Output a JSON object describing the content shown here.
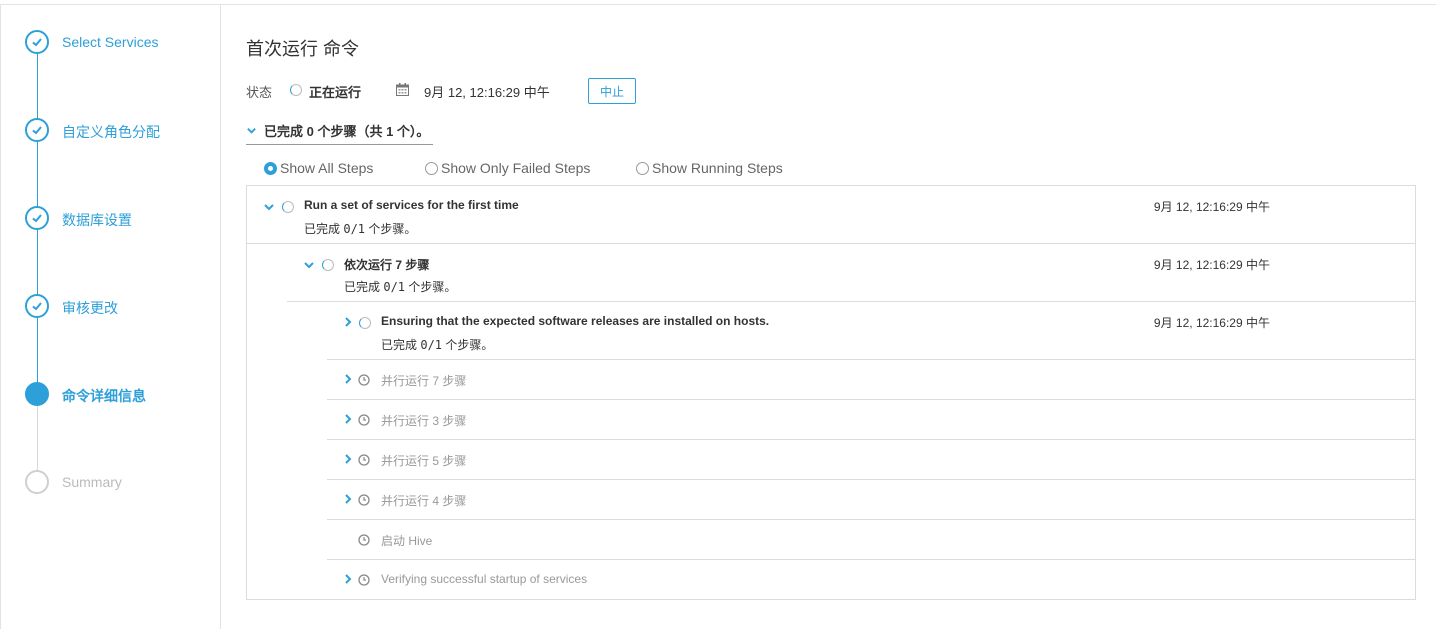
{
  "sidebar": {
    "steps": [
      {
        "label": "Select Services",
        "state": "done"
      },
      {
        "label": "自定义角色分配",
        "state": "done"
      },
      {
        "label": "数据库设置",
        "state": "done"
      },
      {
        "label": "审核更改",
        "state": "done"
      },
      {
        "label": "命令详细信息",
        "state": "active"
      },
      {
        "label": "Summary",
        "state": "pending"
      }
    ]
  },
  "header": {
    "title": "首次运行 命令"
  },
  "status": {
    "label": "状态",
    "value": "正在运行",
    "time": "9月 12, 12:16:29 中午",
    "abort_label": "中止"
  },
  "progress": {
    "summary": "已完成 0 个步骤（共 1 个）。"
  },
  "filters": [
    {
      "label": "Show All Steps",
      "selected": true
    },
    {
      "label": "Show Only Failed Steps",
      "selected": false
    },
    {
      "label": "Show Running Steps",
      "selected": false
    }
  ],
  "steps": [
    {
      "name": "Run a set of services for the first time",
      "sub_prefix": "已完成 ",
      "sub_count": "0/1",
      "sub_suffix": " 个步骤。",
      "time": "9月 12, 12:16:29 中午"
    },
    {
      "name": "依次运行 7 步骤",
      "sub_prefix": "已完成 ",
      "sub_count": "0/1",
      "sub_suffix": " 个步骤。",
      "time": "9月 12, 12:16:29 中午"
    },
    {
      "name": "Ensuring that the expected software releases are installed on hosts.",
      "sub_prefix": "已完成 ",
      "sub_count": "0/1",
      "sub_suffix": " 个步骤。",
      "time": "9月 12, 12:16:29 中午"
    },
    {
      "name": "并行运行 7 步骤"
    },
    {
      "name": "并行运行 3 步骤"
    },
    {
      "name": "并行运行 5 步骤"
    },
    {
      "name": "并行运行 4 步骤"
    },
    {
      "name": "启动 Hive"
    },
    {
      "name": "Verifying successful startup of services"
    }
  ],
  "colors": {
    "accent": "#2d9fd9",
    "muted": "#999999",
    "border": "#dcdcdc"
  }
}
